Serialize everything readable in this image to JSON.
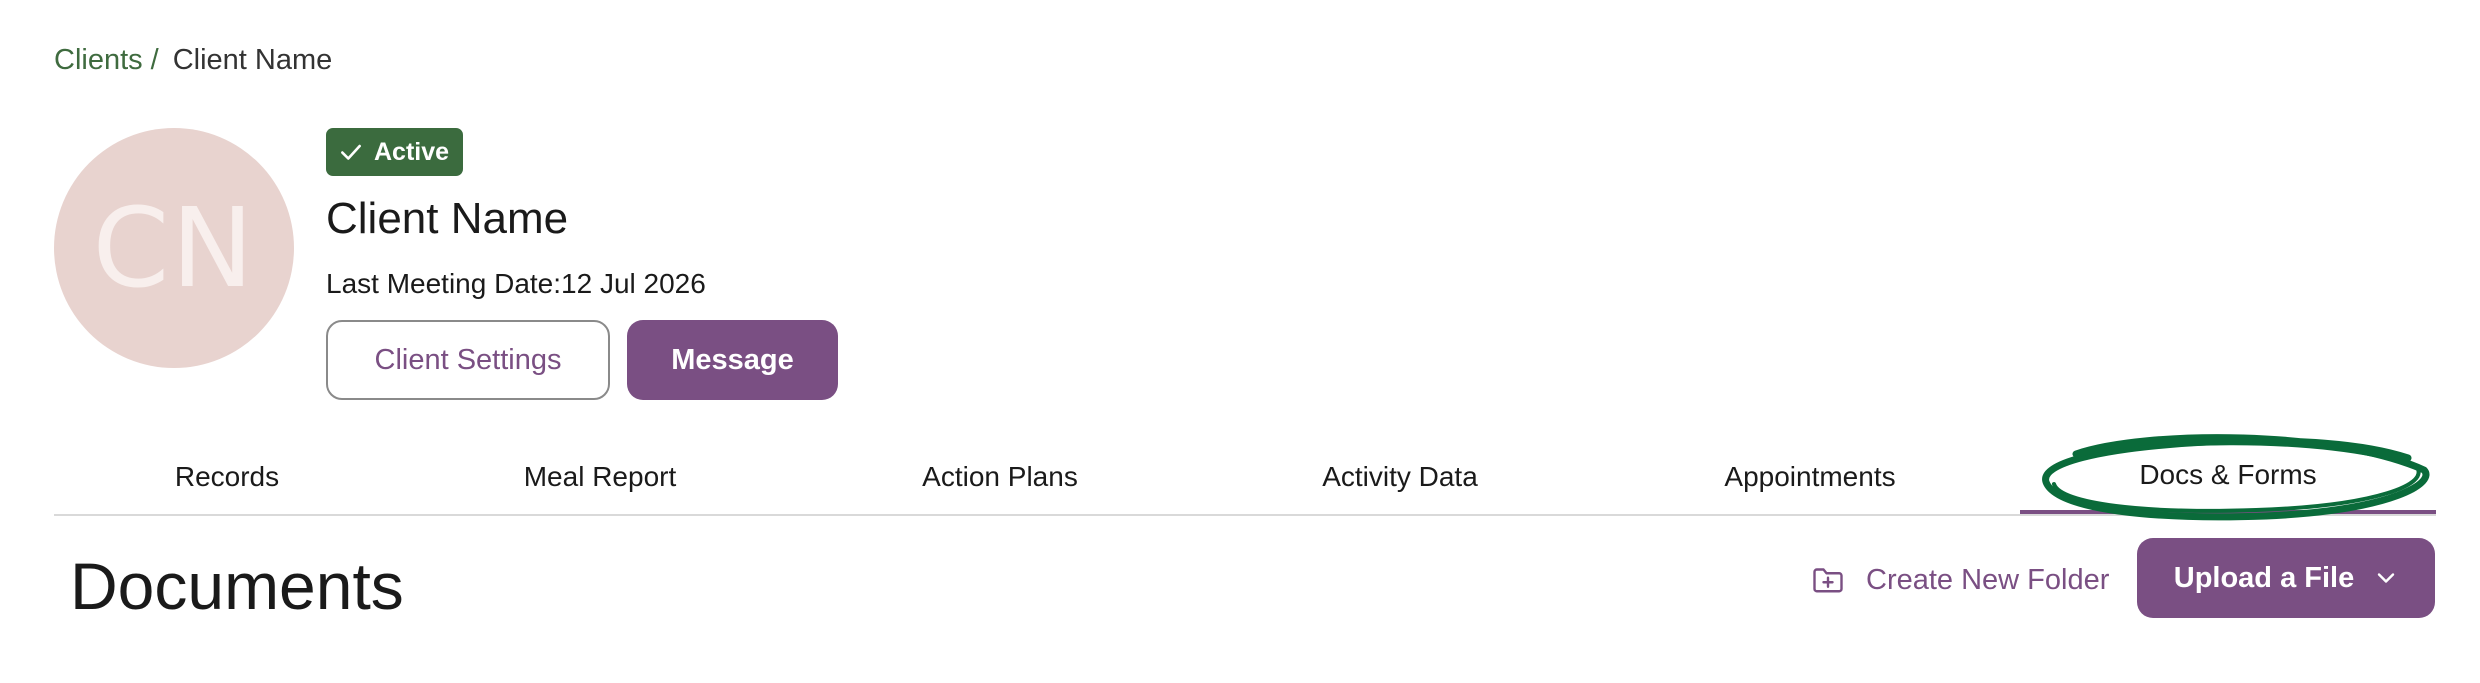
{
  "breadcrumb": {
    "parent": "Clients",
    "separator": "/",
    "current": "Client Name"
  },
  "client": {
    "initials": "CN",
    "status": "Active",
    "name": "Client Name",
    "last_meeting_label": "Last Meeting Date:",
    "last_meeting_value": "12 Jul 2026"
  },
  "actions": {
    "settings_label": "Client Settings",
    "message_label": "Message"
  },
  "tabs": [
    {
      "label": "Records"
    },
    {
      "label": "Meal Report"
    },
    {
      "label": "Action Plans"
    },
    {
      "label": "Activity Data"
    },
    {
      "label": "Appointments"
    },
    {
      "label": "Docs & Forms",
      "active": true
    }
  ],
  "documents": {
    "title": "Documents",
    "create_folder_label": "Create New Folder",
    "upload_label": "Upload a File"
  },
  "icons": {
    "status": "check-icon",
    "create_folder": "folder-plus-icon",
    "upload_menu": "chevron-down-icon"
  },
  "colors": {
    "brand_purple": "#7a4f83",
    "status_green": "#3b6b3e",
    "breadcrumb_green": "#3f6b3f",
    "avatar_bg": "#e8d3cf",
    "highlight_ring": "#0a6b3a"
  }
}
